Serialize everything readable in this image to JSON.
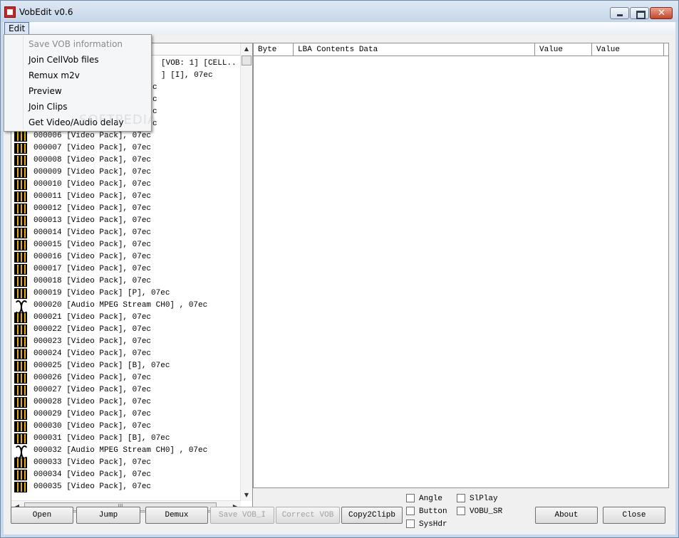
{
  "window": {
    "title": "VobEdit v0.6"
  },
  "menu": {
    "edit_label": "Edit",
    "items": [
      {
        "label": "Save VOB information",
        "enabled": false
      },
      {
        "label": "Join CellVob files",
        "enabled": true
      },
      {
        "label": "Remux m2v",
        "enabled": true
      },
      {
        "label": "Preview",
        "enabled": true
      },
      {
        "label": "Join Clips",
        "enabled": true
      },
      {
        "label": "Get Video/Audio delay",
        "enabled": true
      }
    ]
  },
  "list": {
    "partial_rows": [
      "[VOB: 1] [CELL..",
      "] [I], 07ec",
      "c",
      "c",
      "c",
      "c"
    ],
    "rows": [
      {
        "text": "000006 [Video Pack], 07ec",
        "icon": "video-icon"
      },
      {
        "text": "000007 [Video Pack], 07ec",
        "icon": "video-icon"
      },
      {
        "text": "000008 [Video Pack], 07ec",
        "icon": "video-icon"
      },
      {
        "text": "000009 [Video Pack], 07ec",
        "icon": "video-icon"
      },
      {
        "text": "000010 [Video Pack], 07ec",
        "icon": "video-icon"
      },
      {
        "text": "000011 [Video Pack], 07ec",
        "icon": "video-icon"
      },
      {
        "text": "000012 [Video Pack], 07ec",
        "icon": "video-icon"
      },
      {
        "text": "000013 [Video Pack], 07ec",
        "icon": "video-icon"
      },
      {
        "text": "000014 [Video Pack], 07ec",
        "icon": "video-icon"
      },
      {
        "text": "000015 [Video Pack], 07ec",
        "icon": "video-icon"
      },
      {
        "text": "000016 [Video Pack], 07ec",
        "icon": "video-icon"
      },
      {
        "text": "000017 [Video Pack], 07ec",
        "icon": "video-icon"
      },
      {
        "text": "000018 [Video Pack], 07ec",
        "icon": "video-icon"
      },
      {
        "text": "000019 [Video Pack] [P], 07ec",
        "icon": "video-icon"
      },
      {
        "text": "000020 [Audio MPEG Stream CH0] , 07ec",
        "icon": "audio-icon"
      },
      {
        "text": "000021 [Video Pack], 07ec",
        "icon": "video-icon"
      },
      {
        "text": "000022 [Video Pack], 07ec",
        "icon": "video-icon"
      },
      {
        "text": "000023 [Video Pack], 07ec",
        "icon": "video-icon"
      },
      {
        "text": "000024 [Video Pack], 07ec",
        "icon": "video-icon"
      },
      {
        "text": "000025 [Video Pack] [B], 07ec",
        "icon": "video-icon"
      },
      {
        "text": "000026 [Video Pack], 07ec",
        "icon": "video-icon"
      },
      {
        "text": "000027 [Video Pack], 07ec",
        "icon": "video-icon"
      },
      {
        "text": "000028 [Video Pack], 07ec",
        "icon": "video-icon"
      },
      {
        "text": "000029 [Video Pack], 07ec",
        "icon": "video-icon"
      },
      {
        "text": "000030 [Video Pack], 07ec",
        "icon": "video-icon"
      },
      {
        "text": "000031 [Video Pack] [B], 07ec",
        "icon": "video-icon"
      },
      {
        "text": "000032 [Audio MPEG Stream CH0] , 07ec",
        "icon": "audio-icon"
      },
      {
        "text": "000033 [Video Pack], 07ec",
        "icon": "video-icon"
      },
      {
        "text": "000034 [Video Pack], 07ec",
        "icon": "video-icon"
      },
      {
        "text": "000035 [Video Pack], 07ec",
        "icon": "video-icon"
      }
    ],
    "hscroll_grip": "III"
  },
  "table": {
    "headers": [
      "Byte",
      "LBA Contents Data",
      "Value",
      "Value"
    ]
  },
  "buttons": {
    "open": "Open",
    "jump": "Jump",
    "demux": "Demux",
    "save_vob": "Save VOB_I",
    "correct_vob": "Correct VOB",
    "copy2clip": "Copy2Clipb",
    "about": "About",
    "close": "Close"
  },
  "checkboxes": {
    "angle": "Angle",
    "button": "Button",
    "syshdr": "SysHdr",
    "slplay": "SlPlay",
    "vobu_sr": "VOBU_SR"
  },
  "watermark": "SOFTPEDIA"
}
